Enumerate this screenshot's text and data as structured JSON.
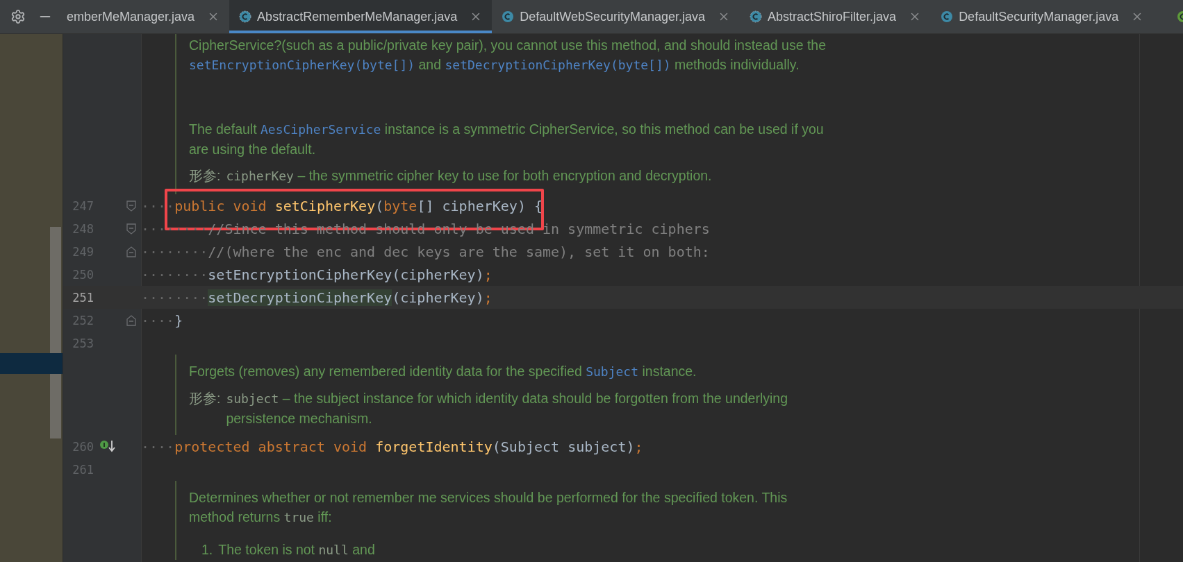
{
  "tab_bar": {
    "tabs": [
      {
        "label": "emberMeManager.java",
        "selected": false
      },
      {
        "label": "AbstractRememberMeManager.java",
        "selected": true,
        "kind": "abstract"
      },
      {
        "label": "DefaultWebSecurityManager.java",
        "selected": false,
        "kind": "class"
      },
      {
        "label": "AbstractShiroFilter.java",
        "selected": false,
        "kind": "abstract"
      },
      {
        "label": "DefaultSecurityManager.java",
        "selected": false,
        "kind": "class"
      }
    ],
    "cut_tab": {
      "kind": "class-green"
    }
  },
  "editor": {
    "lines": [
      {
        "kind": "doc",
        "blocks": [
          {
            "kind": "para",
            "segments": [
              {
                "text": "CipherService?(such as a public/private key pair), you cannot use this method, and should instead use the "
              },
              {
                "code": "setEncryptionCipherKey(byte[])",
                "link": true
              },
              {
                "text": " and "
              },
              {
                "code": "setDecryptionCipherKey(byte[])",
                "link": true
              },
              {
                "text": " methods individually."
              }
            ]
          },
          {
            "kind": "para",
            "segments": [
              {
                "text": "The default "
              },
              {
                "code": "AesCipherService",
                "link": true
              },
              {
                "text": " instance is a symmetric CipherService, so this method can be used if you are using the default."
              }
            ]
          },
          {
            "kind": "param",
            "label": "形参:",
            "name": "cipherKey",
            "description": "– the symmetric cipher key to use for both encryption and decryption."
          }
        ]
      },
      {
        "kind": "code",
        "number": "247",
        "marker": {
          "kind": "fold-start"
        },
        "indent": "····",
        "current": false,
        "boxed": true,
        "tokens": [
          {
            "kind": "keyword",
            "text": "public "
          },
          {
            "kind": "keyword",
            "text": "void "
          },
          {
            "kind": "method",
            "text": "setCipherKey"
          },
          {
            "kind": "plain",
            "text": "("
          },
          {
            "kind": "keyword",
            "text": "byte"
          },
          {
            "kind": "plain",
            "text": "[] cipherKey) {"
          }
        ]
      },
      {
        "kind": "code",
        "number": "248",
        "marker": {
          "kind": "fold-start"
        },
        "indent": "········",
        "current": false,
        "boxed": false,
        "tokens": [
          {
            "kind": "comment",
            "text": "//Since this method should only be used in symmetric ciphers"
          }
        ]
      },
      {
        "kind": "code",
        "number": "249",
        "marker": {
          "kind": "fold-end"
        },
        "indent": "········",
        "current": false,
        "boxed": false,
        "tokens": [
          {
            "kind": "comment",
            "text": "//(where the enc and dec keys are the same), set it on both:"
          }
        ]
      },
      {
        "kind": "code",
        "number": "250",
        "indent": "········",
        "current": false,
        "boxed": false,
        "tokens": [
          {
            "kind": "plain",
            "text": "setEncryptionCipherKey(cipherKey)"
          },
          {
            "kind": "keyword",
            "text": ";"
          }
        ]
      },
      {
        "kind": "code",
        "number": "251",
        "indent": "········",
        "current": true,
        "boxed": false,
        "tokens": [
          {
            "kind": "usage",
            "text": "setDecryptionCipherKey"
          },
          {
            "kind": "plain",
            "text": "(cipherKey)"
          },
          {
            "kind": "keyword",
            "text": ";"
          }
        ]
      },
      {
        "kind": "code",
        "number": "252",
        "marker": {
          "kind": "fold-end"
        },
        "indent": "····",
        "current": false,
        "boxed": false,
        "tokens": [
          {
            "kind": "plain",
            "text": "}"
          }
        ]
      },
      {
        "kind": "code",
        "number": "253",
        "current": false,
        "boxed": false
      },
      {
        "kind": "doc",
        "blocks": [
          {
            "kind": "para",
            "segments": [
              {
                "text": "Forgets (removes) any remembered identity data for the specified "
              },
              {
                "code": "Subject",
                "link": true
              },
              {
                "text": " instance."
              }
            ]
          },
          {
            "kind": "param",
            "label": "形参:",
            "name": "subject",
            "description": "– the subject instance for which identity data should be forgotten from the underlying persistence mechanism."
          }
        ]
      },
      {
        "kind": "code",
        "number": "260",
        "marker": {
          "kind": "implemented"
        },
        "indent": "····",
        "current": false,
        "boxed": false,
        "tokens": [
          {
            "kind": "keyword",
            "text": "protected "
          },
          {
            "kind": "keyword",
            "text": "abstract "
          },
          {
            "kind": "keyword",
            "text": "void "
          },
          {
            "kind": "method",
            "text": "forgetIdentity"
          },
          {
            "kind": "plain",
            "text": "(Subject subject)"
          },
          {
            "kind": "keyword",
            "text": ";"
          }
        ]
      },
      {
        "kind": "code",
        "number": "261",
        "current": false,
        "boxed": false
      },
      {
        "kind": "doc",
        "blocks": [
          {
            "kind": "para",
            "segments": [
              {
                "text": "Determines whether or not remember me services should be performed for the specified token. This method returns "
              },
              {
                "code": "true",
                "link": false
              },
              {
                "text": " iff:"
              }
            ]
          },
          {
            "kind": "list_item",
            "marker": "1.",
            "segments": [
              {
                "text": "The token is not "
              },
              {
                "code": "null",
                "link": false
              },
              {
                "text": " and"
              }
            ]
          }
        ]
      }
    ]
  }
}
